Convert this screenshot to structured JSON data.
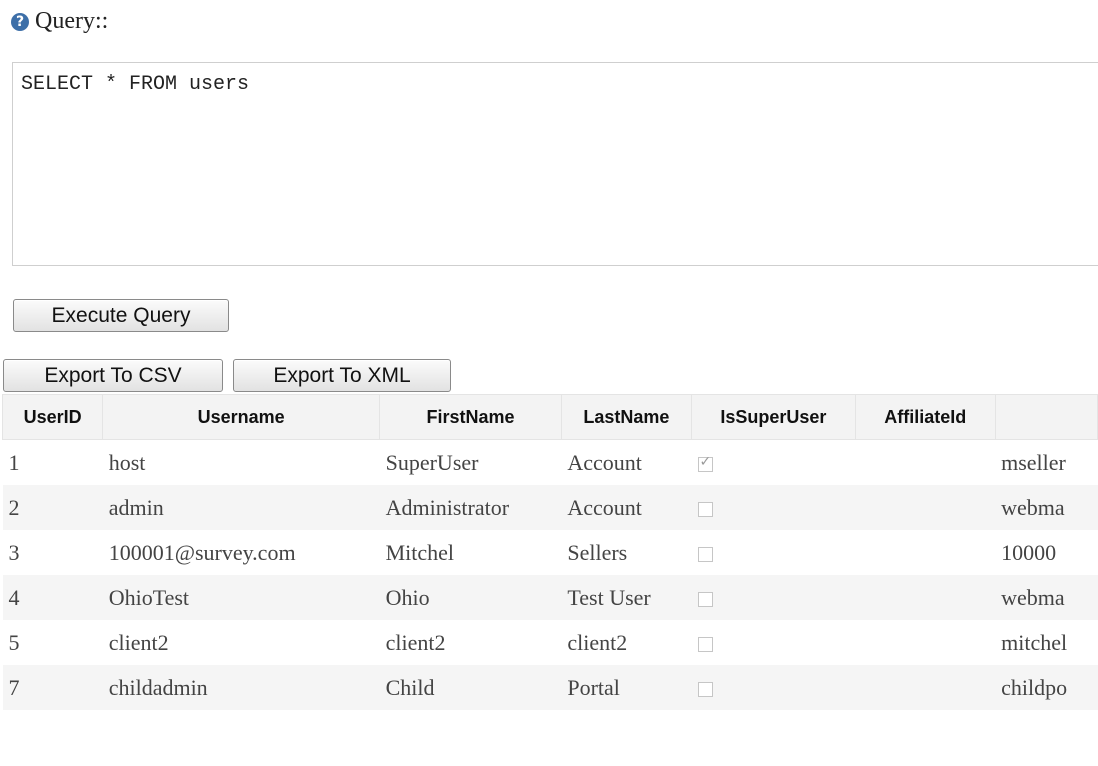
{
  "query": {
    "label": "Query::",
    "value": "SELECT * FROM users"
  },
  "buttons": {
    "execute": "Execute Query",
    "export_csv": "Export To CSV",
    "export_xml": "Export To XML"
  },
  "table": {
    "headers": [
      "UserID",
      "Username",
      "FirstName",
      "LastName",
      "IsSuperUser",
      "AffiliateId",
      ""
    ],
    "rows": [
      {
        "id": "1",
        "username": "host",
        "first": "SuperUser",
        "last": "Account",
        "super": true,
        "affiliate": "",
        "email": "mseller"
      },
      {
        "id": "2",
        "username": "admin",
        "first": "Administrator",
        "last": "Account",
        "super": false,
        "affiliate": "",
        "email": "webma"
      },
      {
        "id": "3",
        "username": "100001@survey.com",
        "first": "Mitchel",
        "last": "Sellers",
        "super": false,
        "affiliate": "",
        "email": "10000"
      },
      {
        "id": "4",
        "username": "OhioTest",
        "first": "Ohio",
        "last": "Test User",
        "super": false,
        "affiliate": "",
        "email": "webma"
      },
      {
        "id": "5",
        "username": "client2",
        "first": "client2",
        "last": "client2",
        "super": false,
        "affiliate": "",
        "email": "mitchel"
      },
      {
        "id": "7",
        "username": "childadmin",
        "first": "Child",
        "last": "Portal",
        "super": false,
        "affiliate": "",
        "email": "childpo"
      }
    ]
  }
}
